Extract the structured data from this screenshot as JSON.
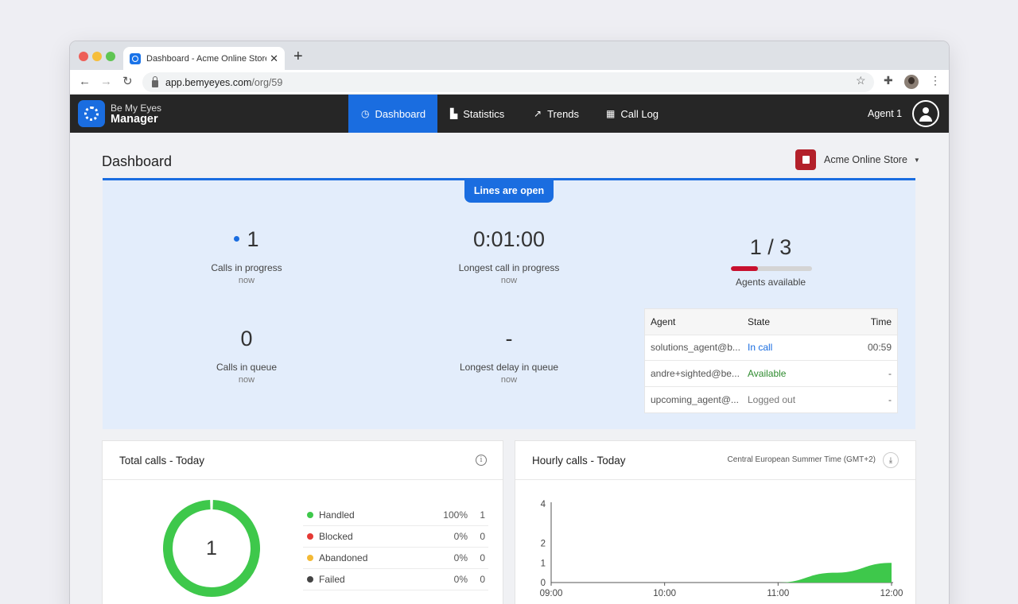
{
  "browser": {
    "tab_title": "Dashboard - Acme Online Store",
    "url_host": "app.bemyeyes.com",
    "url_path": "/org/59",
    "icons": [
      "back-arrow-icon",
      "forward-arrow-icon",
      "reload-icon",
      "lock-icon",
      "star-icon",
      "puzzle-icon",
      "kebab-icon"
    ]
  },
  "app": {
    "brand_top": "Be My Eyes",
    "brand_bottom": "Manager",
    "nav": [
      {
        "label": "Dashboard",
        "icon": "gauge-icon",
        "active": true
      },
      {
        "label": "Statistics",
        "icon": "bar-chart-icon",
        "active": false
      },
      {
        "label": "Trends",
        "icon": "trend-icon",
        "active": false
      },
      {
        "label": "Call Log",
        "icon": "table-icon",
        "active": false
      }
    ],
    "agent_name": "Agent 1",
    "accent": "#1a6de0"
  },
  "page": {
    "title": "Dashboard",
    "org_name": "Acme Online Store"
  },
  "status": {
    "lines_label": "Lines are open",
    "calls_in_progress": {
      "value": "1",
      "label": "Calls in progress",
      "sub": "now"
    },
    "longest_call": {
      "value": "0:01:00",
      "label": "Longest call in progress",
      "sub": "now"
    },
    "agents_available": {
      "value": "1 / 3",
      "label": "Agents available",
      "available": 1,
      "total": 3
    },
    "calls_in_queue": {
      "value": "0",
      "label": "Calls in queue",
      "sub": "now"
    },
    "longest_delay": {
      "value": "-",
      "label": "Longest delay in queue",
      "sub": "now"
    }
  },
  "agents_table": {
    "headers": [
      "Agent",
      "State",
      "Time"
    ],
    "rows": [
      {
        "agent": "solutions_agent@b...",
        "state": "In call",
        "time": "00:59"
      },
      {
        "agent": "andre+sighted@be...",
        "state": "Available",
        "time": "-"
      },
      {
        "agent": "upcoming_agent@...",
        "state": "Logged out",
        "time": "-"
      }
    ]
  },
  "total_calls": {
    "title": "Total calls - Today",
    "total": "1",
    "legend": [
      {
        "name": "Handled",
        "pct": "100%",
        "count": "1",
        "color": "#3ec84b"
      },
      {
        "name": "Blocked",
        "pct": "0%",
        "count": "0",
        "color": "#e53935"
      },
      {
        "name": "Abandoned",
        "pct": "0%",
        "count": "0",
        "color": "#f4b935"
      },
      {
        "name": "Failed",
        "pct": "0%",
        "count": "0",
        "color": "#444444"
      }
    ]
  },
  "hourly_calls": {
    "title": "Hourly calls - Today",
    "timezone": "Central European Summer Time (GMT+2)"
  },
  "chart_data": [
    {
      "type": "pie",
      "labels": [
        "Handled",
        "Blocked",
        "Abandoned",
        "Failed"
      ],
      "values": [
        1,
        0,
        0,
        0
      ],
      "colors": [
        "#3ec84b",
        "#e53935",
        "#f4b935",
        "#444444"
      ],
      "center_label": "1"
    },
    {
      "type": "area",
      "x_ticks": [
        "09:00",
        "10:00",
        "11:00",
        "12:00"
      ],
      "y_ticks": [
        0,
        1,
        2,
        4
      ],
      "points": [
        [
          9,
          0
        ],
        [
          11,
          0
        ],
        [
          11.5,
          0.5
        ],
        [
          12,
          1
        ]
      ],
      "color": "#3ec84b",
      "ylim": [
        0,
        4
      ],
      "xlim": [
        9,
        12
      ]
    }
  ]
}
